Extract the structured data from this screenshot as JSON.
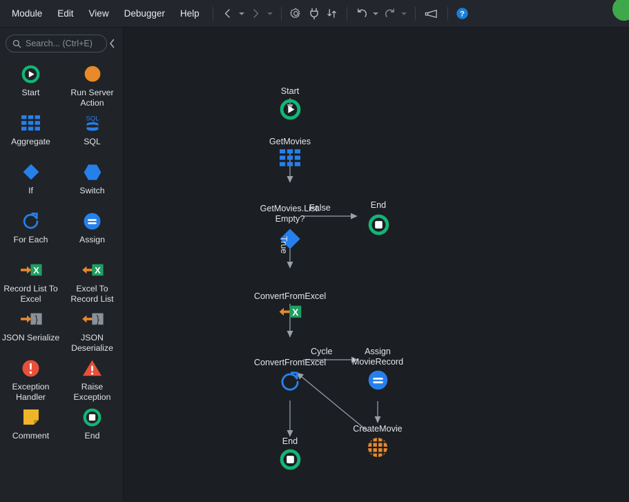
{
  "app": {
    "title": "Service Studio Flow Editor",
    "accent_blue": "#2680eb",
    "accent_green": "#19b36b",
    "accent_orange": "#e8892a",
    "accent_red": "#e8503a",
    "accent_yellow": "#f0b429",
    "canvas_bg": "#1b1e23",
    "sidebar_bg": "#202328",
    "header_bg": "#23262c"
  },
  "header": {
    "menus": [
      {
        "label": "Module",
        "name": "menu-module"
      },
      {
        "label": "Edit",
        "name": "menu-edit"
      },
      {
        "label": "View",
        "name": "menu-view"
      },
      {
        "label": "Debugger",
        "name": "menu-debugger"
      },
      {
        "label": "Help",
        "name": "menu-help"
      }
    ],
    "nav": {
      "back_icon": "chevron-left-icon",
      "back_caret_icon": "chevron-down-icon",
      "forward_icon": "chevron-right-icon",
      "forward_caret_icon": "chevron-down-icon"
    },
    "tools": [
      {
        "name": "settings-gear-icon",
        "icon": "gear-icon"
      },
      {
        "name": "plug-connect-icon",
        "icon": "plug-icon"
      },
      {
        "name": "step-inout-icon",
        "icon": "arrows-updown-icon"
      },
      {
        "name": "undo-icon",
        "icon": "undo-icon"
      },
      {
        "name": "redo-icon",
        "icon": "redo-icon"
      },
      {
        "name": "feedback-megaphone-icon",
        "icon": "megaphone-icon"
      },
      {
        "name": "help-icon",
        "icon": "question-circle-icon"
      }
    ],
    "avatar": {
      "name": "user-avatar",
      "color": "#3fa84a"
    }
  },
  "sidebar": {
    "search": {
      "placeholder": "Search... (Ctrl+E)",
      "value": "",
      "icon": "search-icon"
    },
    "collapse_icon": "chevron-left-icon",
    "tools": [
      {
        "label": "Start",
        "icon": "start-icon",
        "name": "tool-start"
      },
      {
        "label": "Run Server\nAction",
        "icon": "run-server-action-icon",
        "name": "tool-run-server-action"
      },
      {
        "label": "Aggregate",
        "icon": "aggregate-icon",
        "name": "tool-aggregate"
      },
      {
        "label": "SQL",
        "icon": "sql-icon",
        "name": "tool-sql"
      },
      {
        "label": "If",
        "icon": "if-icon",
        "name": "tool-if"
      },
      {
        "label": "Switch",
        "icon": "switch-icon",
        "name": "tool-switch"
      },
      {
        "label": "For Each",
        "icon": "for-each-icon",
        "name": "tool-for-each"
      },
      {
        "label": "Assign",
        "icon": "assign-icon",
        "name": "tool-assign"
      },
      {
        "label": "Record List\nTo Excel",
        "icon": "record-list-to-excel-icon",
        "name": "tool-record-list-to-excel"
      },
      {
        "label": "Excel To\nRecord List",
        "icon": "excel-to-record-list-icon",
        "name": "tool-excel-to-record-list"
      },
      {
        "label": "JSON\nSerialize",
        "icon": "json-serialize-icon",
        "name": "tool-json-serialize"
      },
      {
        "label": "JSON\nDeserialize",
        "icon": "json-deserialize-icon",
        "name": "tool-json-deserialize"
      },
      {
        "label": "Exception\nHandler",
        "icon": "exception-handler-icon",
        "name": "tool-exception-handler"
      },
      {
        "label": "Raise\nException",
        "icon": "raise-exception-icon",
        "name": "tool-raise-exception"
      },
      {
        "label": "Comment",
        "icon": "comment-icon",
        "name": "tool-comment"
      },
      {
        "label": "End",
        "icon": "end-icon",
        "name": "tool-end"
      }
    ]
  },
  "canvas": {
    "nodes": [
      {
        "id": "start",
        "label": "Start",
        "icon": "start-icon",
        "name": "node-start"
      },
      {
        "id": "getmovies",
        "label": "GetMovies",
        "icon": "aggregate-icon",
        "name": "node-getmovies"
      },
      {
        "id": "if",
        "label": "GetMovies.List.\nEmpty?",
        "icon": "if-icon",
        "name": "node-getmovies-list-empty"
      },
      {
        "id": "end1",
        "label": "End",
        "icon": "end-icon",
        "name": "node-end-false-branch"
      },
      {
        "id": "convert",
        "label": "ConvertFromExcel",
        "icon": "excel-to-record-list-icon",
        "name": "node-convertfromexcel"
      },
      {
        "id": "foreach",
        "label": "ConvertFromExcel",
        "icon": "for-each-icon",
        "name": "node-foreach-convertfromexcel"
      },
      {
        "id": "assign",
        "label": "Assign\nMovieRecord",
        "icon": "assign-icon",
        "name": "node-assign-movierecord"
      },
      {
        "id": "createmovie",
        "label": "CreateMovie",
        "icon": "create-movie-icon",
        "name": "node-createmovie"
      },
      {
        "id": "end2",
        "label": "End",
        "icon": "end-icon",
        "name": "node-end-loop"
      }
    ],
    "edge_labels": [
      {
        "text": "False",
        "name": "edge-label-false"
      },
      {
        "text": "True",
        "name": "edge-label-true"
      },
      {
        "text": "Cycle",
        "name": "edge-label-cycle"
      }
    ]
  }
}
